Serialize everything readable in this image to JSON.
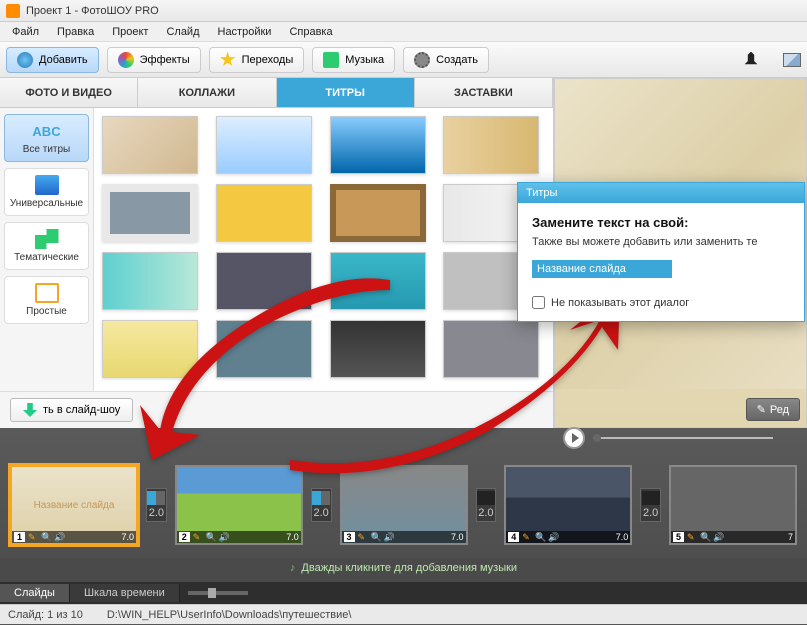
{
  "window": {
    "title": "Проект 1 - ФотоШОУ PRO"
  },
  "menu": {
    "items": [
      "Файл",
      "Правка",
      "Проект",
      "Слайд",
      "Настройки",
      "Справка"
    ]
  },
  "toolbar": {
    "add": "Добавить",
    "effects": "Эффекты",
    "transitions": "Переходы",
    "music": "Музыка",
    "create": "Создать"
  },
  "tabs": {
    "photo_video": "ФОТО И ВИДЕО",
    "collages": "КОЛЛАЖИ",
    "titles": "ТИТРЫ",
    "screensavers": "ЗАСТАВКИ"
  },
  "sidebar": {
    "all": {
      "icon": "ABC",
      "label": "Все титры"
    },
    "universal": {
      "label": "Универсальные"
    },
    "thematic": {
      "label": "Тематические"
    },
    "simple": {
      "label": "Простые"
    }
  },
  "add_to_slideshow": "ть в слайд-шоу",
  "edit_button": "Ред",
  "dialog": {
    "title": "Титры",
    "heading": "Замените текст на свой:",
    "subtext": "Также вы можете добавить или заменить те",
    "input_value": "Название слайда",
    "checkbox_label": "Не показывать этот диалог"
  },
  "timeline": {
    "slides": [
      {
        "num": "1",
        "label": "Название слайда",
        "duration": "7.0",
        "selected": true,
        "trans": "2.0"
      },
      {
        "num": "2",
        "label": "",
        "duration": "7.0",
        "selected": false,
        "trans": "2.0"
      },
      {
        "num": "3",
        "label": "",
        "duration": "7.0",
        "selected": false,
        "trans": "2.0"
      },
      {
        "num": "4",
        "label": "",
        "duration": "7.0",
        "selected": false,
        "trans": "2.0"
      },
      {
        "num": "5",
        "label": "",
        "duration": "7",
        "selected": false,
        "trans": ""
      }
    ],
    "music_hint": "Дважды кликните для добавления музыки"
  },
  "bottom": {
    "tab_slides": "Слайды",
    "tab_timeline": "Шкала времени"
  },
  "status": {
    "slide_count": "Слайд: 1 из 10",
    "path": "D:\\WIN_HELP\\UserInfo\\Downloads\\путешествие\\"
  },
  "thumb_styles": [
    "background:linear-gradient(135deg,#e8d8c0,#d0b890)",
    "background:linear-gradient(#def,#9cf)",
    "background:linear-gradient(#8cf,#06a)",
    "background:linear-gradient(90deg,#e8d0a0,#d8b870)",
    "background:#8899a5;border:8px solid #e8e8e8",
    "background:#f5c842",
    "background:#c89858;border:6px solid #8a6838",
    "background:linear-gradient(90deg,#e8e8e8,#f5f5f5)",
    "background:linear-gradient(90deg,#5ed0d0,#b8e8d8)",
    "background:#556",
    "background:linear-gradient(#3ab8c8,#2598b0)",
    "background:#c0c0c0",
    "background:linear-gradient(#f5e8a0,#e8d870)",
    "background:#608090",
    "background:linear-gradient(#333,#555)",
    "background:#888890"
  ],
  "slide_backgrounds": [
    "background:linear-gradient(#ebe3ca,#ddd0a8)",
    "background:linear-gradient(#5b9bd5 35%,#8bc34a 35%)",
    "background:linear-gradient(#888,#7090a0)",
    "background:linear-gradient(#4a5568 40%,#2d3748 40%)",
    "background:#666"
  ]
}
